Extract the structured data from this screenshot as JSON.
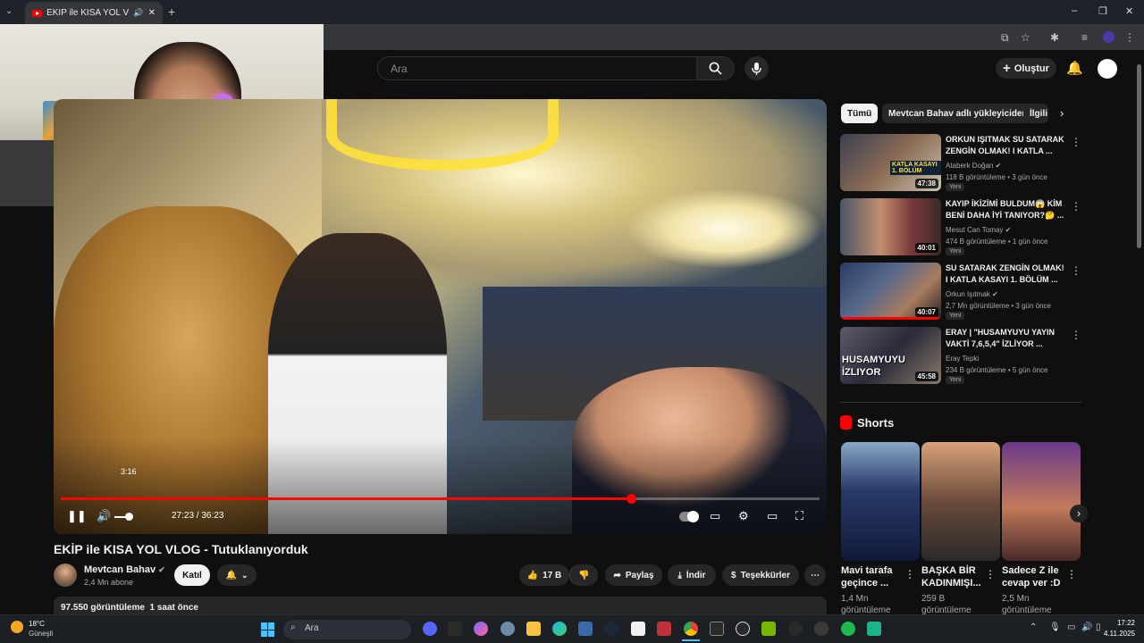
{
  "browser": {
    "tab_title": "EKİP ile KISA YOL VLOG - Tu",
    "new_tab_symbol": "+",
    "window_controls": [
      "–",
      "❐",
      "✕"
    ]
  },
  "header": {
    "search_placeholder": "Ara",
    "create_label": "Oluştur"
  },
  "player": {
    "tooltip_time": "3:16",
    "current_time": "27:23",
    "duration": "36:23",
    "time_display": "27:23 / 36:23",
    "progress_fraction": 0.752
  },
  "video": {
    "title": "EKİP ile KISA YOL VLOG - Tutuklanıyorduk",
    "channel": "Mevtcan Bahav",
    "subscribers": "2,4 Mn abone",
    "join_label": "Katıl",
    "likes": "17 B",
    "share_label": "Paylaş",
    "download_label": "İndir",
    "thanks_label": "Teşekkürler",
    "views_date": "97.550 görüntüleme  1 saat önce"
  },
  "sidebar": {
    "chips": [
      "Tümü",
      "Mevtcan Bahav adlı yükleyiciden",
      "İlgili"
    ],
    "recommendations": [
      {
        "title": "ORKUN IŞITMAK SU SATARAK ZENGİN OLMAK! I KATLA ...",
        "channel": "Ataberk Doğan",
        "meta": "118 B görüntüleme • 3 gün önce",
        "badge": "Yeni",
        "duration": "47:38"
      },
      {
        "title": "KAYIP İKİZİMİ BULDUM😱 KİM BENİ DAHA İYİ TANIYOR?🤔 ...",
        "channel": "Mesut Can Tomay",
        "meta": "474 B görüntüleme • 1 gün önce",
        "badge": "Yeni",
        "duration": "40:01"
      },
      {
        "title": "SU SATARAK ZENGİN OLMAK! I KATLA KASAYI 1. BÖLÜM ...",
        "channel": "Orkun Işıtmak",
        "meta": "2,7 Mn görüntüleme • 3 gün önce",
        "badge": "Yeni",
        "duration": "40:07"
      },
      {
        "title": "ERAY | \"HUSAMYUYU YAYIN VAKTİ 7,6,5,4\" İZLİYOR ...",
        "channel": "Eray Tepki",
        "meta": "234 B görüntüleme • 5 gün önce",
        "badge": "Yeni",
        "duration": "45:58"
      }
    ],
    "thumb_captions": [
      "KATLA KASAYI 1. BÖLÜM",
      "HUSAMYUYU İZLIYOR"
    ],
    "shorts_title": "Shorts",
    "shorts": [
      {
        "title": "Mavi tarafa geçince ...",
        "views": "1,4 Mn görüntüleme"
      },
      {
        "title": "BAŞKA BİR KADINMIŞI...",
        "views": "259 B görüntüleme"
      },
      {
        "title": "Sadece Z ile cevap ver :D",
        "views": "2,5 Mn görüntüleme"
      }
    ]
  },
  "taskbar": {
    "weather_temp": "18°C",
    "weather_desc": "Güneşli",
    "search_label": "Ara",
    "time": "17:22",
    "date": "4.11.2025"
  }
}
